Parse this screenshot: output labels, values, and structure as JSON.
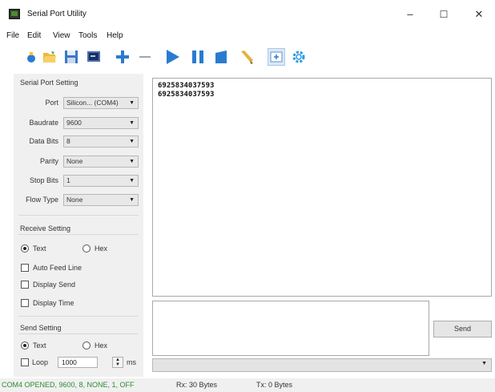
{
  "window": {
    "title": "Serial Port Utility",
    "minimize": "–",
    "maximize": "☐",
    "close": "✕"
  },
  "menu": [
    "File",
    "Edit",
    "View",
    "Tools",
    "Help"
  ],
  "toolbar": {
    "icons": [
      "clear-icon",
      "open-icon",
      "save-icon",
      "terminal-icon",
      "add-icon",
      "remove-icon",
      "start-icon",
      "pause-icon",
      "stop-icon",
      "brush-icon",
      "window-icon",
      "settings-icon"
    ]
  },
  "serial_setting": {
    "title": "Serial Port Setting",
    "fields": [
      {
        "label": "Port",
        "value": "Silicon... (COM4)"
      },
      {
        "label": "Baudrate",
        "value": "9600"
      },
      {
        "label": "Data Bits",
        "value": "8"
      },
      {
        "label": "Parity",
        "value": "None"
      },
      {
        "label": "Stop Bits",
        "value": "1"
      },
      {
        "label": "Flow Type",
        "value": "None"
      }
    ]
  },
  "receive_setting": {
    "title": "Receive Setting",
    "text_label": "Text",
    "hex_label": "Hex",
    "selected": "Text",
    "options": [
      "Auto Feed Line",
      "Display Send",
      "Display Time"
    ]
  },
  "send_setting": {
    "title": "Send Setting",
    "text_label": "Text",
    "hex_label": "Hex",
    "selected": "Text",
    "loop_label": "Loop",
    "loop_value": "1000",
    "loop_unit": "ms"
  },
  "receive_area": {
    "lines": [
      "6925834037593",
      "6925834037593"
    ]
  },
  "send_area": {
    "value": "",
    "send_label": "Send"
  },
  "status": {
    "port": "COM4 OPENED, 9600, 8, NONE, 1, OFF",
    "rx": "Rx: 30 Bytes",
    "tx": "Tx: 0 Bytes",
    "port_color": "#2e8b2e"
  },
  "colors": {
    "accent": "#1e73c8",
    "window_bg": "#f0f0f0"
  }
}
